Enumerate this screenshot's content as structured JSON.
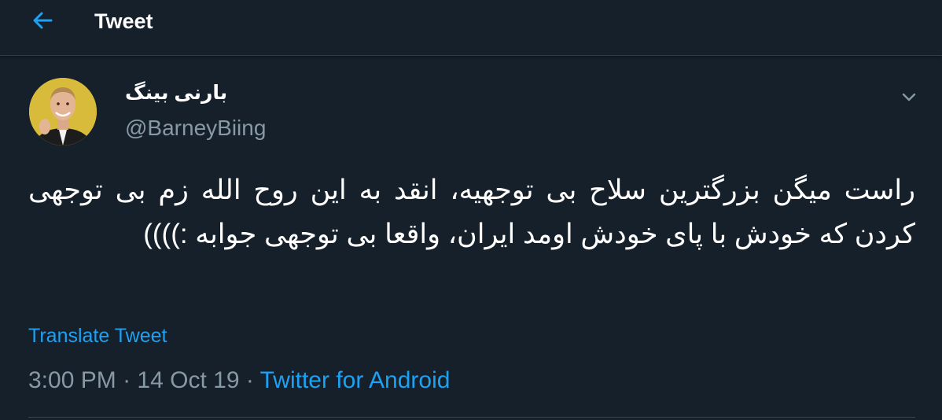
{
  "colors": {
    "background": "#15202b",
    "accent": "#1da1f2",
    "secondary_text": "#8899a6",
    "primary_text": "#ffffff",
    "divider": "#38444d"
  },
  "header": {
    "back_icon": "arrow-left-icon",
    "title": "Tweet"
  },
  "tweet": {
    "author": {
      "display_name": "بارنی بینگ",
      "handle": "@BarneyBiing"
    },
    "menu_icon": "chevron-down-icon",
    "text": "راست میگن بزرگترین سلاح بی توجهیه، انقد به این روح الله زم بی توجهی کردن که خودش با پای خودش اومد ایران، واقعا بی توجهی جوابه :))))",
    "translate_label": "Translate Tweet",
    "time": "3:00 PM",
    "separator": "·",
    "date": "14 Oct 19",
    "source": "Twitter for Android"
  }
}
